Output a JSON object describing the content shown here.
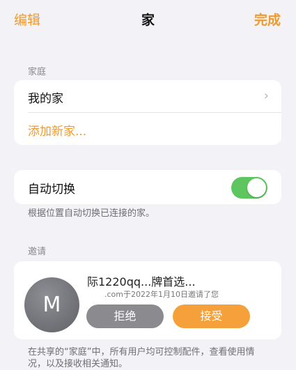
{
  "nav": {
    "edit_label": "编辑",
    "title": "家",
    "done_label": "完成"
  },
  "home_section": {
    "header": "家庭",
    "items": [
      {
        "label": "我的家"
      },
      {
        "label": "添加新家..."
      }
    ]
  },
  "auto_switch": {
    "label": "自动切换",
    "enabled": true,
    "footnote": "根据位置自动切换已连接的家。"
  },
  "invites_section": {
    "header": "邀请",
    "invite": {
      "avatar_letter": "M",
      "name": "际1220qq...牌首选...",
      "meta": ".com于2022年1月10日邀请了您",
      "decline_label": "拒绝",
      "accept_label": "接受"
    },
    "footnote": "在共享的“家庭”中，所有用户均可控制配件，查看使用情况，以及接收相关通知。"
  },
  "colors": {
    "accent": "#f09a2e",
    "toggle_on": "#5dc65e",
    "background": "#f2f2f7"
  }
}
